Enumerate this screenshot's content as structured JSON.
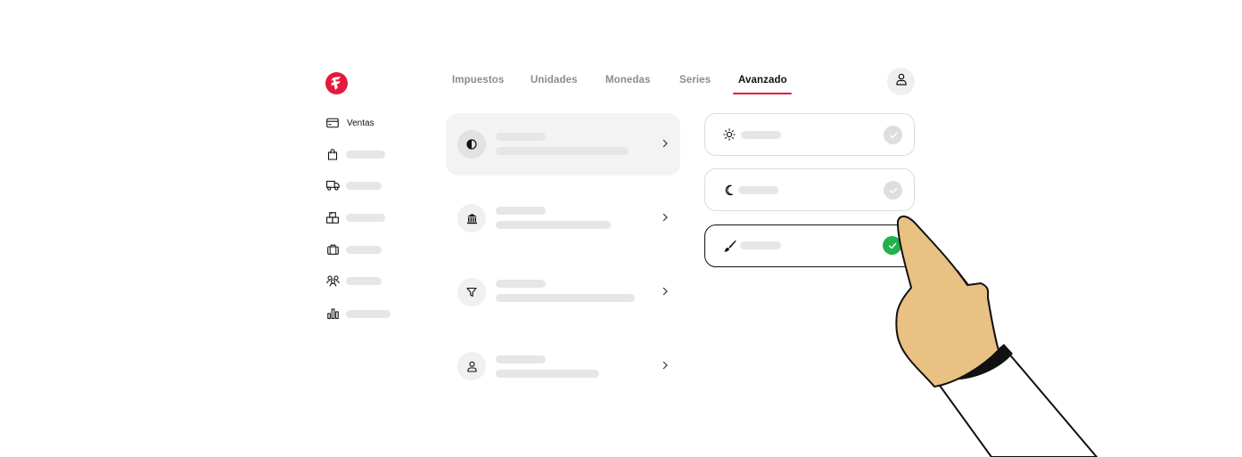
{
  "sidebar": {
    "items": [
      {
        "icon": "credit-card-icon",
        "label": "Ventas"
      },
      {
        "icon": "shopping-bag-icon",
        "label": ""
      },
      {
        "icon": "truck-icon",
        "label": ""
      },
      {
        "icon": "boxes-icon",
        "label": ""
      },
      {
        "icon": "briefcase-icon",
        "label": ""
      },
      {
        "icon": "users-icon",
        "label": ""
      },
      {
        "icon": "bar-chart-icon",
        "label": ""
      }
    ]
  },
  "tabs": [
    {
      "label": "Impuestos"
    },
    {
      "label": "Unidades"
    },
    {
      "label": "Monedas"
    },
    {
      "label": "Series"
    },
    {
      "label": "Avanzado"
    }
  ],
  "active_tab": "Avanzado",
  "settings_list": [
    {
      "icon": "contrast-icon",
      "selected": true
    },
    {
      "icon": "bank-icon",
      "selected": false
    },
    {
      "icon": "filter-icon",
      "selected": false
    },
    {
      "icon": "user-icon",
      "selected": false
    }
  ],
  "theme_options": [
    {
      "icon": "sun-icon",
      "selected": false
    },
    {
      "icon": "moon-icon",
      "selected": false
    },
    {
      "icon": "paintbrush-icon",
      "selected": true
    }
  ],
  "colors": {
    "accent": "#e4193b",
    "success": "#22b14c",
    "hand_skin": "#e8c183"
  }
}
